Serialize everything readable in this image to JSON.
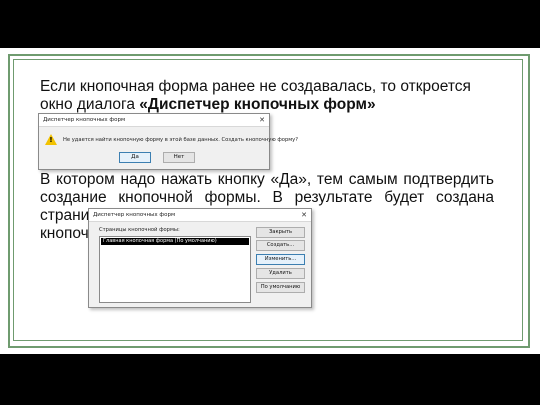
{
  "paragraph1": {
    "line1": "Если кнопочная форма ранее не создавалась, то откроется",
    "line2_plain": "окно диалога ",
    "line2_bold": "«Диспетчер кнопочных форм»"
  },
  "paragraph2": {
    "text": "В котором надо нажать кнопку «Да», тем самым подтвердить создание кнопочной формы. В результате будет создана страница Главной",
    "last_line": "кнопочной"
  },
  "dialog1": {
    "title": "Диспетчер кнопочных форм",
    "message": "Не удается найти кнопочную форму в этой базе данных.  Создать кнопочную форму?",
    "yes_label": "Да",
    "no_label": "Нет"
  },
  "dialog2": {
    "title": "Диспетчер кнопочных форм",
    "list_label": "Страницы кнопочной формы:",
    "list_items": [
      "Главная кнопочная форма (По умолчанию)"
    ],
    "buttons": {
      "close": "Закрыть",
      "create": "Создать...",
      "edit": "Изменить...",
      "delete": "Удалить",
      "default": "По умолчанию"
    }
  },
  "colors": {
    "frame": "#6f9b6f",
    "background": "#000000"
  }
}
